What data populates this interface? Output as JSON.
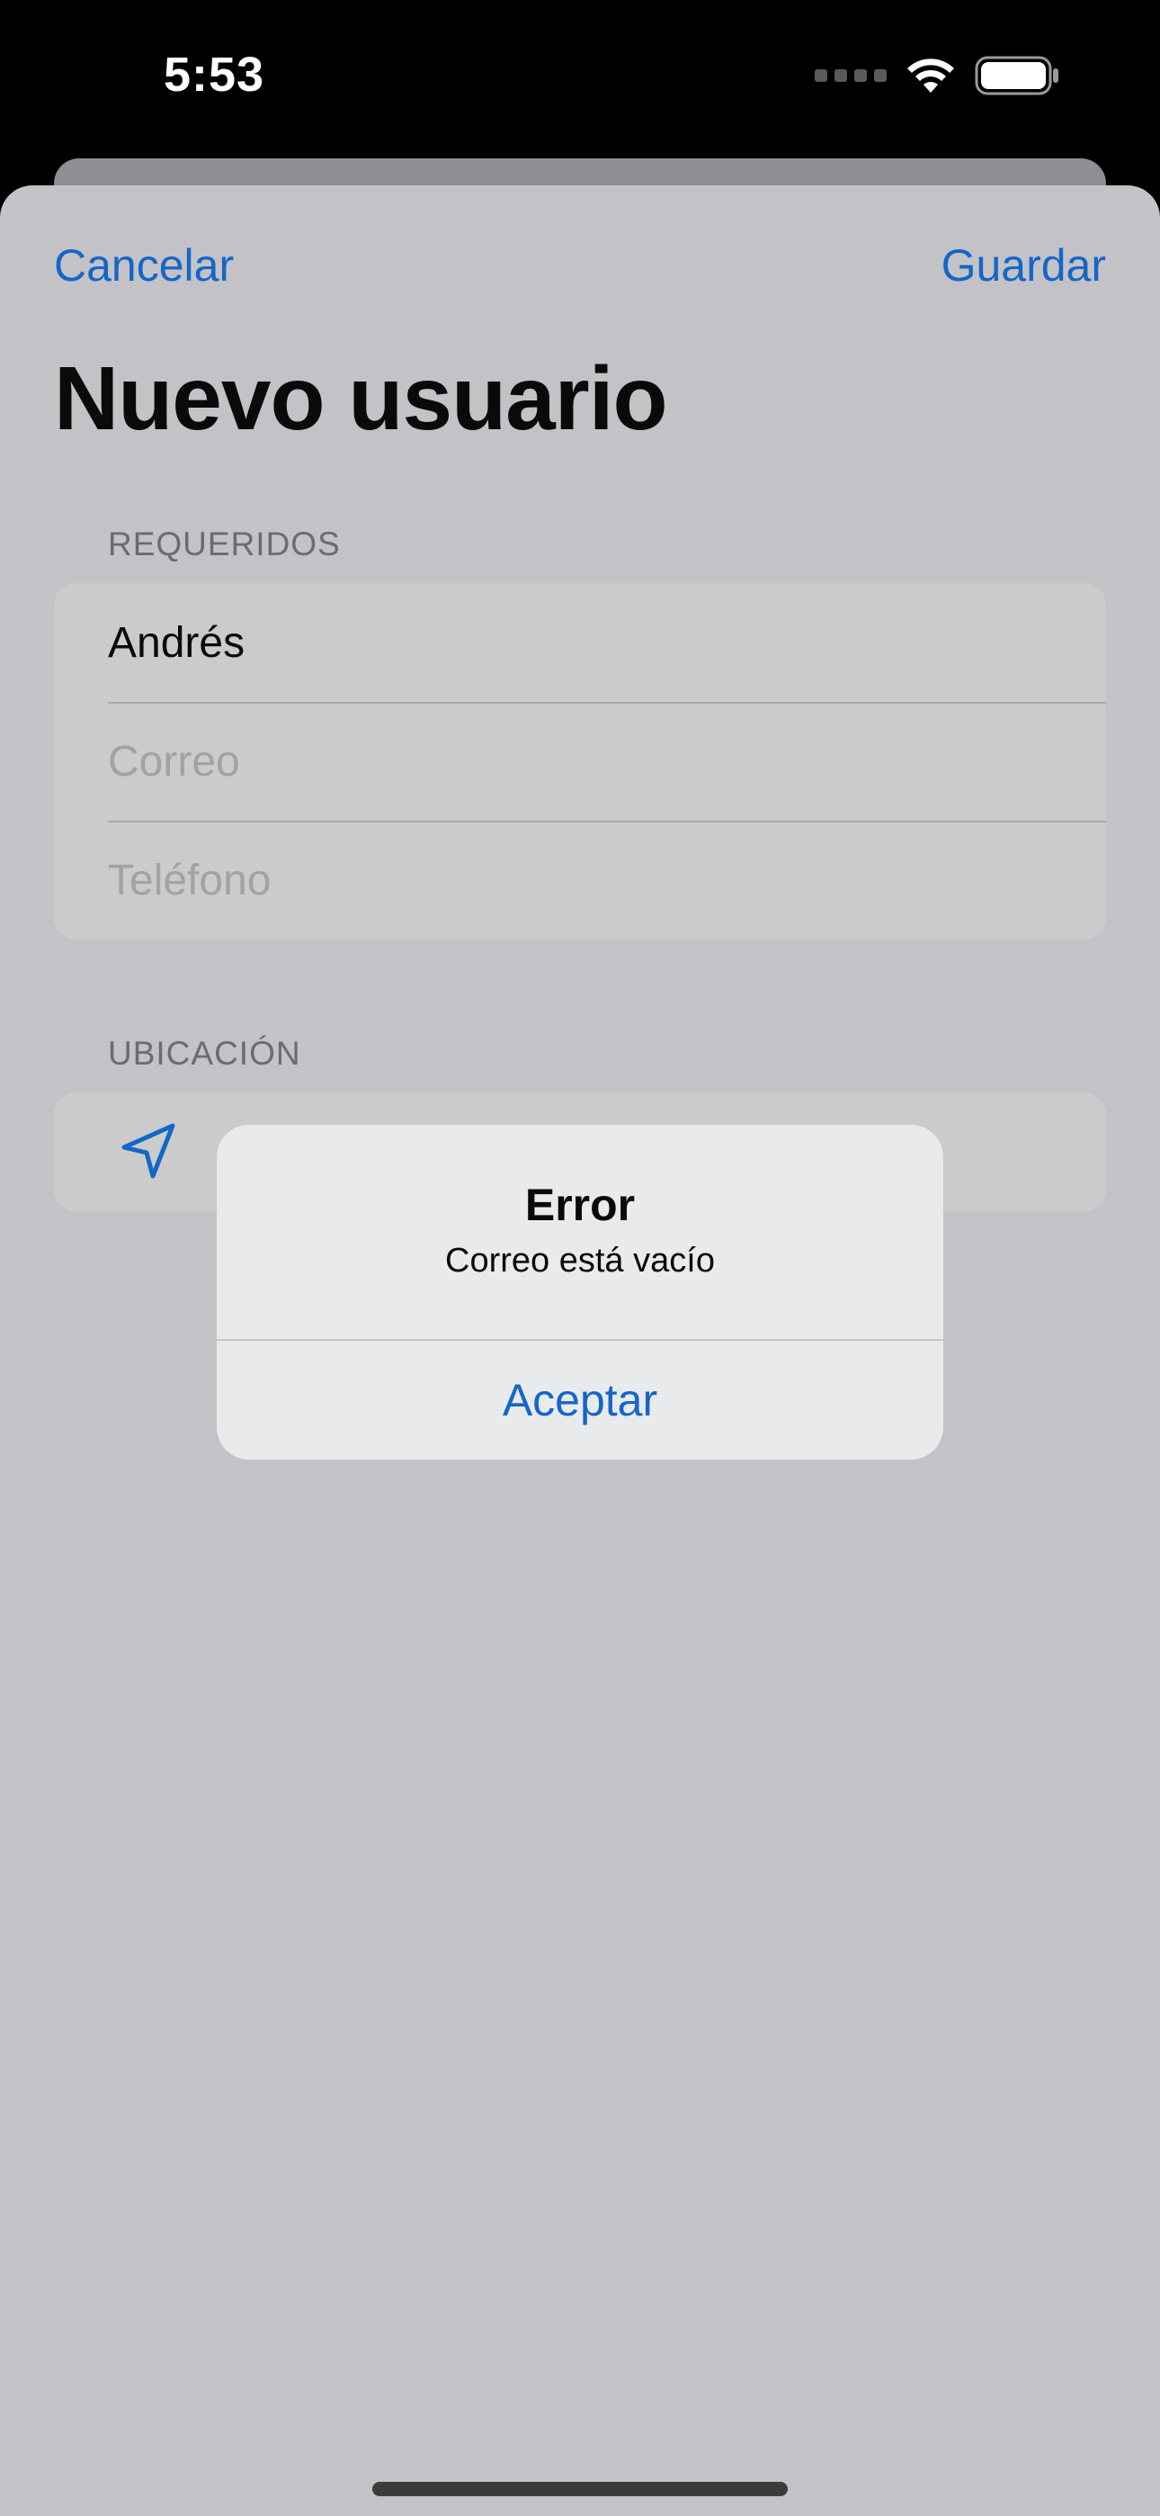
{
  "status_bar": {
    "time": "5:53",
    "wifi_icon": "wifi-icon",
    "battery_icon": "battery-icon",
    "signal_icon": "cellular-signal-icon"
  },
  "nav": {
    "cancel_label": "Cancelar",
    "save_label": "Guardar"
  },
  "page": {
    "title": "Nuevo usuario"
  },
  "sections": {
    "required": {
      "header": "REQUERIDOS",
      "name_value": "Andrés",
      "email_placeholder": "Correo",
      "phone_placeholder": "Teléfono"
    },
    "location": {
      "header": "UBICACIÓN",
      "icon": "location-arrow-icon"
    }
  },
  "alert": {
    "title": "Error",
    "message": "Correo está vacío",
    "button_label": "Aceptar"
  },
  "colors": {
    "accent": "#1466c8",
    "sheet_background": "#c3c2c7",
    "alert_background": "#e9eaec"
  }
}
